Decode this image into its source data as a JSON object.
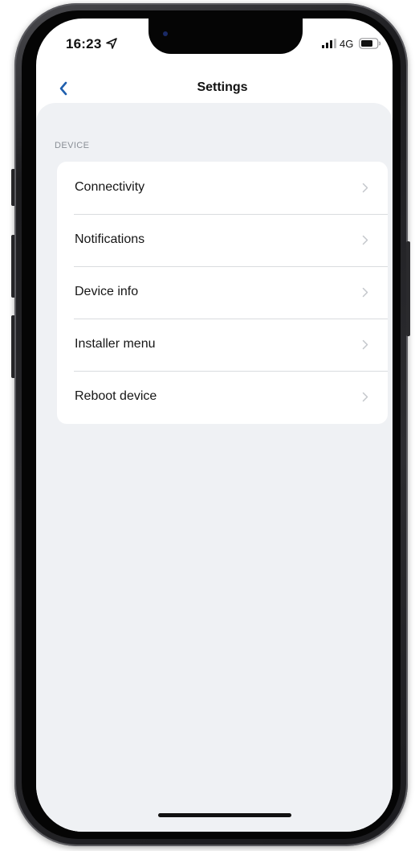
{
  "status_bar": {
    "time": "16:23",
    "network_type": "4G",
    "icons": [
      "location-arrow-icon",
      "signal-bars-icon",
      "battery-icon"
    ]
  },
  "nav": {
    "title": "Settings",
    "back_icon": "chevron-left-icon"
  },
  "sections": [
    {
      "header": "DEVICE",
      "items": [
        {
          "label": "Connectivity",
          "icon": "chevron-right-icon"
        },
        {
          "label": "Notifications",
          "icon": "chevron-right-icon"
        },
        {
          "label": "Device info",
          "icon": "chevron-right-icon"
        },
        {
          "label": "Installer menu",
          "icon": "chevron-right-icon"
        },
        {
          "label": "Reboot device",
          "icon": "chevron-right-icon"
        }
      ]
    }
  ],
  "colors": {
    "accent": "#1f5fae",
    "background": "#eff1f4",
    "card": "#ffffff",
    "section_header": "#8a8f96",
    "chevron": "#c4c7cc"
  }
}
